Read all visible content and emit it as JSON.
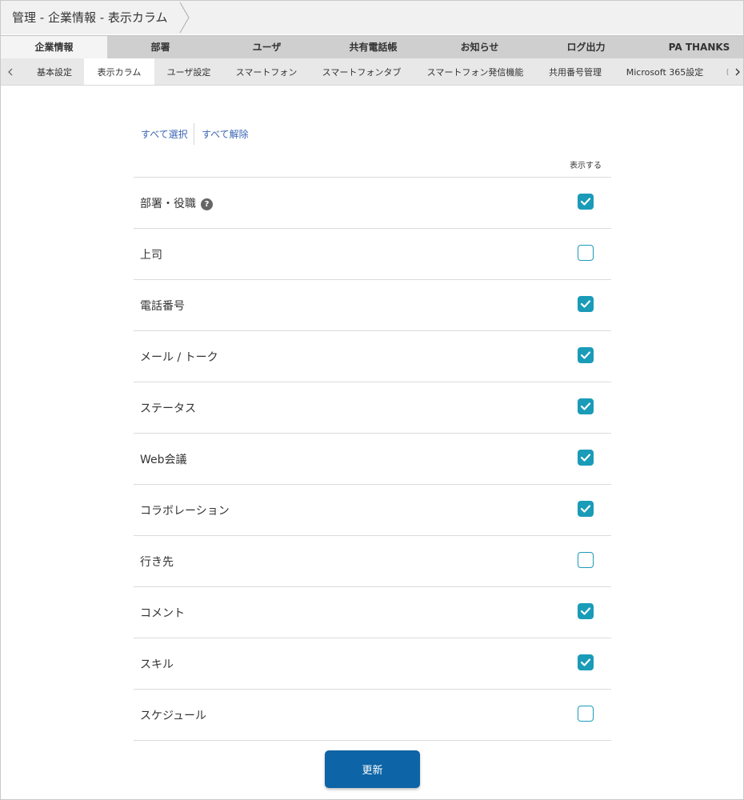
{
  "breadcrumb": {
    "text": "管理 - 企業情報 - 表示カラム"
  },
  "main_tabs": [
    {
      "label": "企業情報",
      "active": true
    },
    {
      "label": "部署",
      "active": false
    },
    {
      "label": "ユーザ",
      "active": false
    },
    {
      "label": "共有電話帳",
      "active": false
    },
    {
      "label": "お知らせ",
      "active": false
    },
    {
      "label": "ログ出力",
      "active": false
    },
    {
      "label": "PA THANKS",
      "active": false
    }
  ],
  "sub_tabs": [
    {
      "label": "基本設定",
      "active": false
    },
    {
      "label": "表示カラム",
      "active": true
    },
    {
      "label": "ユーザ設定",
      "active": false
    },
    {
      "label": "スマートフォン",
      "active": false
    },
    {
      "label": "スマートフォンタブ",
      "active": false
    },
    {
      "label": "スマートフォン発信機能",
      "active": false
    },
    {
      "label": "共用番号管理",
      "active": false
    },
    {
      "label": "Microsoft 365設定",
      "active": false
    }
  ],
  "actions": {
    "select_all": "すべて選択",
    "deselect_all": "すべて解除"
  },
  "column_header": "表示する",
  "columns": [
    {
      "label": "部署・役職",
      "checked": true,
      "help": "?"
    },
    {
      "label": "上司",
      "checked": false
    },
    {
      "label": "電話番号",
      "checked": true
    },
    {
      "label": "メール / トーク",
      "checked": true
    },
    {
      "label": "ステータス",
      "checked": true
    },
    {
      "label": "Web会議",
      "checked": true
    },
    {
      "label": "コラボレーション",
      "checked": true
    },
    {
      "label": "行き先",
      "checked": false
    },
    {
      "label": "コメント",
      "checked": true
    },
    {
      "label": "スキル",
      "checked": true
    },
    {
      "label": "スケジュール",
      "checked": false
    }
  ],
  "update_button": "更新",
  "colors": {
    "accent": "#1a9bb8",
    "primary_button": "#0d64a6",
    "link": "#3b66b4"
  },
  "icons": {
    "help": "question-circle-icon",
    "check": "check-icon",
    "prev": "chevron-left-icon",
    "next": "chevron-right-icon"
  }
}
